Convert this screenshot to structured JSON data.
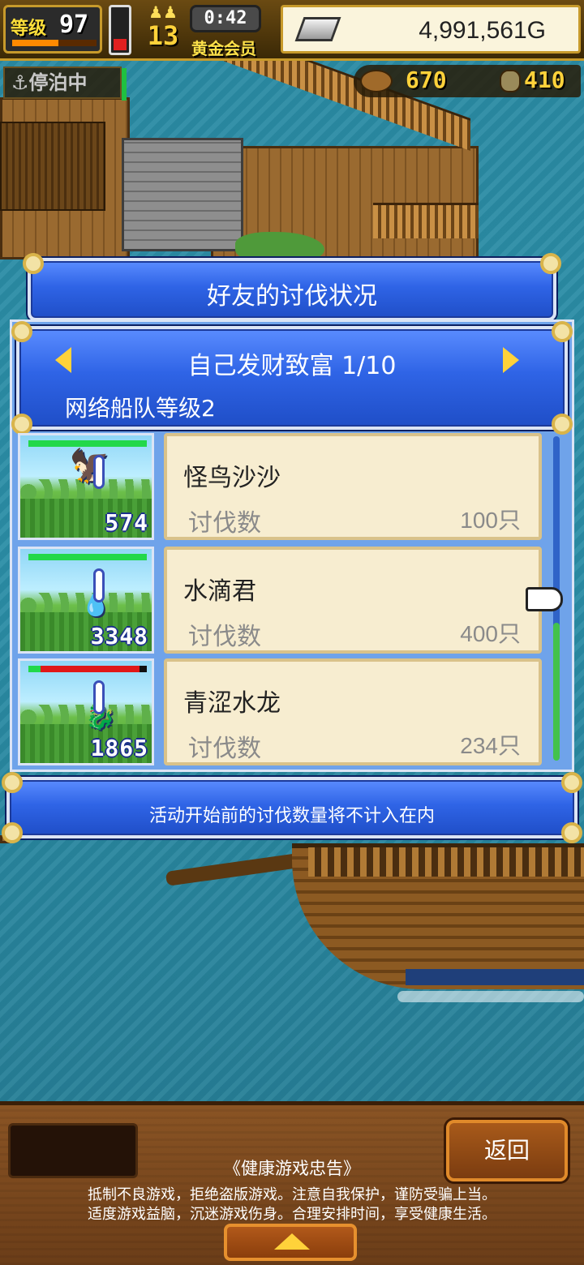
{
  "hud": {
    "level_label": "等级",
    "level_value": "97",
    "level_progress": 0.55,
    "energy_level": 0.25,
    "crew_value": "13",
    "timer": "0:42",
    "membership": "黄金会员",
    "gold": "4,991,561G",
    "status": "停泊中",
    "resource_a": "670",
    "resource_b": "410"
  },
  "dialog": {
    "title": "好友的讨伐状况",
    "header_title": "自己发财致富 1/10",
    "header_subtitle": "网络船队等级2",
    "rows": [
      {
        "name": "怪鸟沙沙",
        "label": "讨伐数",
        "value": "100只",
        "monster_count": "574",
        "hp": 1.0,
        "monster_icon": "bird-icon"
      },
      {
        "name": "水滴君",
        "label": "讨伐数",
        "value": "400只",
        "monster_count": "3348",
        "hp": 1.0,
        "monster_icon": "droplet-icon"
      },
      {
        "name": "青涩水龙",
        "label": "讨伐数",
        "value": "234只",
        "monster_count": "1865",
        "hp": 0.1,
        "monster_icon": "dragon-icon"
      }
    ],
    "notice": "活动开始前的讨伐数量将不计入在内"
  },
  "bottom": {
    "back_label": "返回",
    "advice_title": "《健康游戏忠告》",
    "advice_line1": "抵制不良游戏，拒绝盗版游戏。注意自我保护，谨防受骗上当。",
    "advice_line2": "适度游戏益脑，沉迷游戏伤身。合理安排时间，享受健康生活。"
  },
  "colors": {
    "panel_blue": "#2f64e6",
    "card_bg": "#f7edd0",
    "hp_green": "#22d84a",
    "hp_red": "#e01818",
    "gold_text": "#ffd23a"
  }
}
